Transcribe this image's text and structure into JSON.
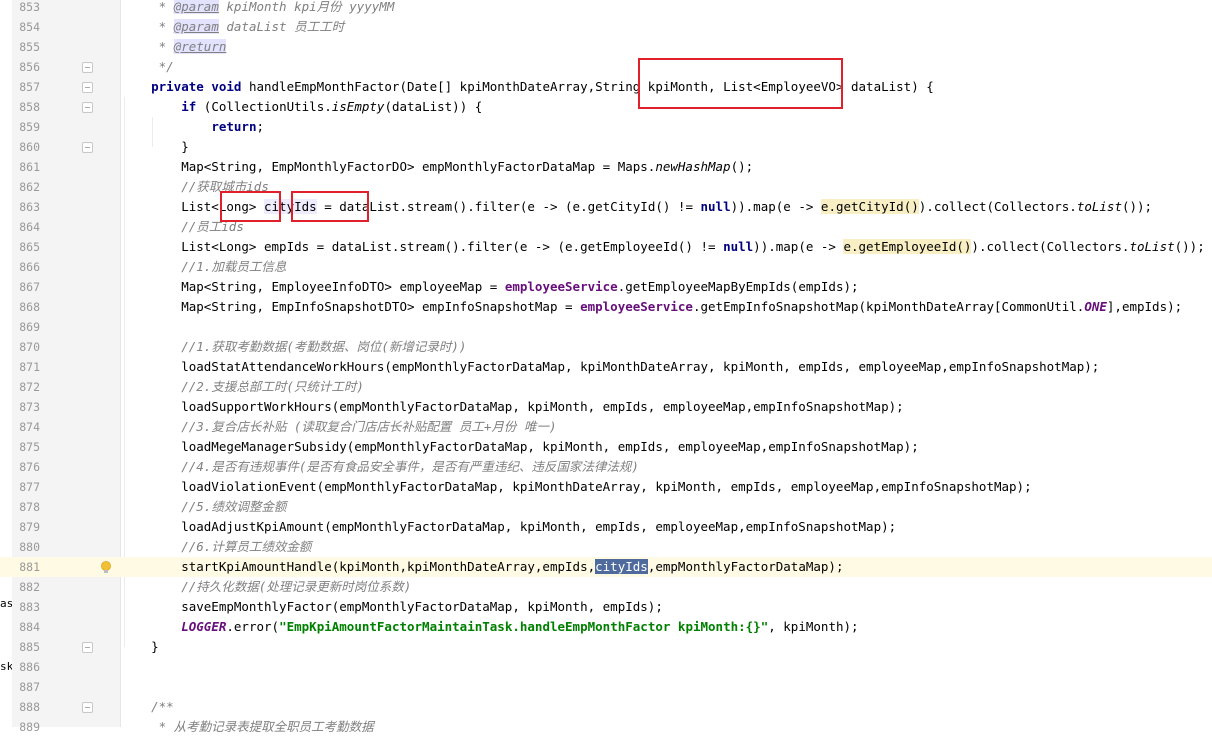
{
  "left_fragments": [
    "as",
    "sk"
  ],
  "lines": [
    {
      "num": "853",
      "segs": [
        {
          "t": "     * ",
          "c": "cm"
        },
        {
          "t": "@param",
          "c": "tag"
        },
        {
          "t": " kpiMonth",
          "c": "cm"
        },
        {
          "t": " kpi月份 yyyyMM",
          "c": "cm"
        }
      ]
    },
    {
      "num": "854",
      "segs": [
        {
          "t": "     * ",
          "c": "cm"
        },
        {
          "t": "@param",
          "c": "tag"
        },
        {
          "t": " dataList",
          "c": "cm"
        },
        {
          "t": " 员工工时",
          "c": "cm"
        }
      ]
    },
    {
      "num": "855",
      "segs": [
        {
          "t": "     * ",
          "c": "cm"
        },
        {
          "t": "@return",
          "c": "tag"
        }
      ]
    },
    {
      "num": "856",
      "fold": true,
      "segs": [
        {
          "t": "     */",
          "c": "cm"
        }
      ]
    },
    {
      "num": "857",
      "fold": true,
      "segs": [
        {
          "t": "    "
        },
        {
          "t": "private void",
          "c": "kw"
        },
        {
          "t": " handleEmpMonthFactor(Date[] kpiMonthDateArray,String kpiMonth, List<EmployeeVO> dataList) {"
        }
      ]
    },
    {
      "num": "858",
      "fold": true,
      "segs": [
        {
          "t": "        "
        },
        {
          "t": "if",
          "c": "kw"
        },
        {
          "t": " (CollectionUtils."
        },
        {
          "t": "isEmpty",
          "c": "static"
        },
        {
          "t": "(dataList)) {"
        }
      ]
    },
    {
      "num": "859",
      "segs": [
        {
          "t": "            "
        },
        {
          "t": "return",
          "c": "kw"
        },
        {
          "t": ";"
        }
      ]
    },
    {
      "num": "860",
      "fold": true,
      "segs": [
        {
          "t": "        }"
        }
      ]
    },
    {
      "num": "861",
      "segs": [
        {
          "t": "        Map<String, EmpMonthlyFactorDO> empMonthlyFactorDataMap = Maps."
        },
        {
          "t": "newHashMap",
          "c": "static"
        },
        {
          "t": "();"
        }
      ]
    },
    {
      "num": "862",
      "segs": [
        {
          "t": "        "
        },
        {
          "t": "//获取城市ids",
          "c": "cm"
        }
      ]
    },
    {
      "num": "863",
      "segs": [
        {
          "t": "        List<Long> "
        },
        {
          "t": "cityIds",
          "c": "hl-use"
        },
        {
          "t": " = dataList.stream().filter(e -> (e.getCityId() != "
        },
        {
          "t": "null",
          "c": "kw"
        },
        {
          "t": ")).map(e -> "
        },
        {
          "t": "e.getCityId()",
          "c": "hl-yellow"
        },
        {
          "t": ").collect(Collectors."
        },
        {
          "t": "toList",
          "c": "static"
        },
        {
          "t": "());"
        }
      ]
    },
    {
      "num": "864",
      "segs": [
        {
          "t": "        "
        },
        {
          "t": "//员工ids",
          "c": "cm"
        }
      ]
    },
    {
      "num": "865",
      "segs": [
        {
          "t": "        List<Long> empIds = dataList.stream().filter(e -> (e.getEmployeeId() != "
        },
        {
          "t": "null",
          "c": "kw"
        },
        {
          "t": ")).map(e -> "
        },
        {
          "t": "e.getEmployeeId()",
          "c": "hl-yellow"
        },
        {
          "t": ").collect(Collectors."
        },
        {
          "t": "toList",
          "c": "static"
        },
        {
          "t": "());"
        }
      ]
    },
    {
      "num": "866",
      "segs": [
        {
          "t": "        "
        },
        {
          "t": "//1.加载员工信息",
          "c": "cm"
        }
      ]
    },
    {
      "num": "867",
      "segs": [
        {
          "t": "        Map<String, EmployeeInfoDTO> employeeMap = "
        },
        {
          "t": "employeeService",
          "c": "fld"
        },
        {
          "t": ".getEmployeeMapByEmpIds(empIds);"
        }
      ]
    },
    {
      "num": "868",
      "segs": [
        {
          "t": "        Map<String, EmpInfoSnapshotDTO> empInfoSnapshotMap = "
        },
        {
          "t": "employeeService",
          "c": "fld"
        },
        {
          "t": ".getEmpInfoSnapshotMap(kpiMonthDateArray[CommonUtil."
        },
        {
          "t": "ONE",
          "c": "const"
        },
        {
          "t": "],empIds);"
        }
      ]
    },
    {
      "num": "869",
      "segs": []
    },
    {
      "num": "870",
      "segs": [
        {
          "t": "        "
        },
        {
          "t": "//1.获取考勤数据(考勤数据、岗位(新增记录时))",
          "c": "cm"
        }
      ]
    },
    {
      "num": "871",
      "segs": [
        {
          "t": "        loadStatAttendanceWorkHours(empMonthlyFactorDataMap, kpiMonthDateArray, kpiMonth, empIds, employeeMap,empInfoSnapshotMap);"
        }
      ]
    },
    {
      "num": "872",
      "segs": [
        {
          "t": "        "
        },
        {
          "t": "//2.支援总部工时(只统计工时)",
          "c": "cm"
        }
      ]
    },
    {
      "num": "873",
      "segs": [
        {
          "t": "        loadSupportWorkHours(empMonthlyFactorDataMap, kpiMonth, empIds, employeeMap,empInfoSnapshotMap);"
        }
      ]
    },
    {
      "num": "874",
      "segs": [
        {
          "t": "        "
        },
        {
          "t": "//3.复合店长补贴 (读取复合门店店长补贴配置 员工+月份 唯一)",
          "c": "cm"
        }
      ]
    },
    {
      "num": "875",
      "segs": [
        {
          "t": "        loadMegeManagerSubsidy(empMonthlyFactorDataMap, kpiMonth, empIds, employeeMap,empInfoSnapshotMap);"
        }
      ]
    },
    {
      "num": "876",
      "segs": [
        {
          "t": "        "
        },
        {
          "t": "//4.是否有违规事件(是否有食品安全事件，是否有严重违纪、违反国家法律法规)",
          "c": "cm"
        }
      ]
    },
    {
      "num": "877",
      "segs": [
        {
          "t": "        loadViolationEvent(empMonthlyFactorDataMap, kpiMonthDateArray, kpiMonth, empIds, employeeMap,empInfoSnapshotMap);"
        }
      ]
    },
    {
      "num": "878",
      "segs": [
        {
          "t": "        "
        },
        {
          "t": "//5.绩效调整金额",
          "c": "cm"
        }
      ]
    },
    {
      "num": "879",
      "segs": [
        {
          "t": "        loadAdjustKpiAmount(empMonthlyFactorDataMap, kpiMonth, empIds, employeeMap,empInfoSnapshotMap);"
        }
      ]
    },
    {
      "num": "880",
      "segs": [
        {
          "t": "        "
        },
        {
          "t": "//6.计算员工绩效金额",
          "c": "cm"
        }
      ]
    },
    {
      "num": "881",
      "current": true,
      "bulb": true,
      "segs": [
        {
          "t": "        startKpiAmountHandle(kpiMonth,kpiMonthDateArray,empIds,"
        },
        {
          "t": "cityIds",
          "c": "hl-sel"
        },
        {
          "t": ",empMonthlyFactorDataMap);"
        }
      ]
    },
    {
      "num": "882",
      "segs": [
        {
          "t": "        "
        },
        {
          "t": "//持久化数据(处理记录更新时岗位系数)",
          "c": "cm"
        }
      ]
    },
    {
      "num": "883",
      "segs": [
        {
          "t": "        saveEmpMonthlyFactor(empMonthlyFactorDataMap, kpiMonth, empIds);"
        }
      ]
    },
    {
      "num": "884",
      "segs": [
        {
          "t": "        "
        },
        {
          "t": "LOGGER",
          "c": "const"
        },
        {
          "t": ".error("
        },
        {
          "t": "\"EmpKpiAmountFactorMaintainTask.handleEmpMonthFactor kpiMonth:{}\"",
          "c": "str"
        },
        {
          "t": ", kpiMonth);"
        }
      ]
    },
    {
      "num": "885",
      "fold": true,
      "segs": [
        {
          "t": "    }"
        }
      ]
    },
    {
      "num": "886",
      "segs": []
    },
    {
      "num": "887",
      "segs": []
    },
    {
      "num": "888",
      "fold": true,
      "segs": [
        {
          "t": "    "
        },
        {
          "t": "/**",
          "c": "cm"
        }
      ]
    },
    {
      "num": "889",
      "segs": [
        {
          "t": "     * 从考勤记录表提取全职员工考勤数据",
          "c": "cm"
        }
      ]
    }
  ]
}
